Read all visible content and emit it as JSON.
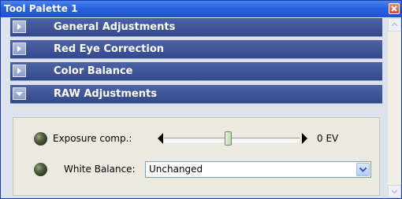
{
  "window": {
    "title": "Tool Palette 1",
    "close_icon": "close-x-icon"
  },
  "sections": [
    {
      "label": "General Adjustments",
      "state": "collapsed",
      "icon": "expand-arrow-right-icon"
    },
    {
      "label": "Red Eye Correction",
      "state": "collapsed",
      "icon": "expand-arrow-right-icon"
    },
    {
      "label": "Color Balance",
      "state": "collapsed",
      "icon": "expand-arrow-right-icon"
    },
    {
      "label": "RAW Adjustments",
      "state": "expanded",
      "icon": "collapse-arrow-down-icon"
    }
  ],
  "raw": {
    "exposure": {
      "label": "Exposure comp.:",
      "value_text": "0 EV",
      "left_icon": "arrow-left-icon",
      "right_icon": "arrow-right-icon"
    },
    "white_balance": {
      "label": "White Balance:",
      "selected": "Unchanged",
      "dropdown_icon": "chevron-down-icon"
    }
  },
  "scrollbar": {
    "up_icon": "arrow-up-icon",
    "down_icon": "arrow-down-icon"
  },
  "colors": {
    "titlebar": "#2a62e0",
    "section_header": "#3f5597",
    "panel_bg": "#eceae0"
  }
}
